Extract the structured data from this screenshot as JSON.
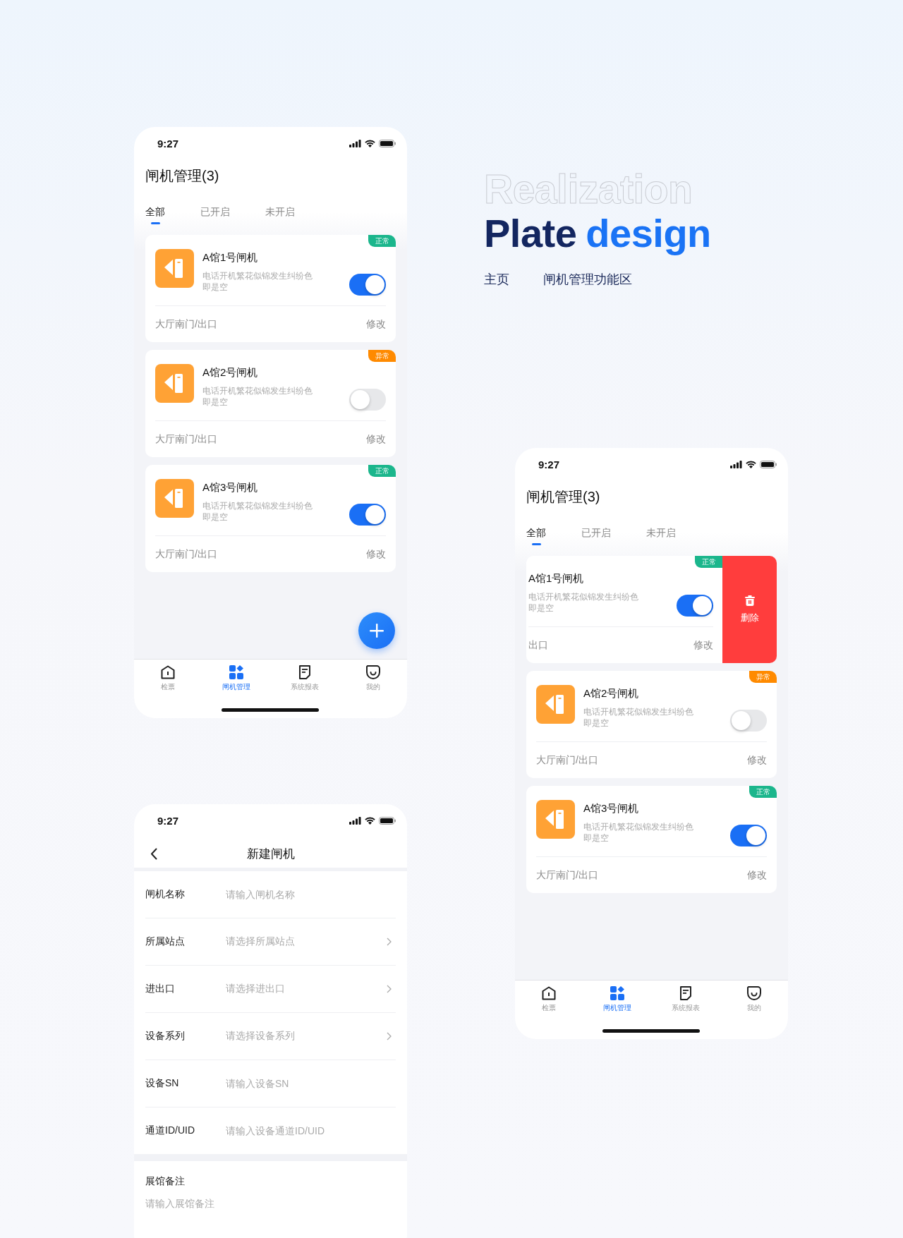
{
  "list_screens": [
    {
      "time": "9:27",
      "title": "闸机管理(3)",
      "tabs": [
        {
          "label": "全部",
          "selected": true
        },
        {
          "label": "已开启",
          "selected": false
        },
        {
          "label": "未开启",
          "selected": false
        }
      ],
      "cards": [
        {
          "name": "A馆1号闸机",
          "desc": "电话开机繁花似锦发生纠纷色即是空",
          "location": "大厅南门/出口",
          "edit": "修改",
          "status": "正常",
          "color": "#1bb68c",
          "on": true,
          "swiped": false
        },
        {
          "name": "A馆2号闸机",
          "desc": "电话开机繁花似锦发生纠纷色即是空",
          "location": "大厅南门/出口",
          "edit": "修改",
          "status": "异常",
          "color": "#ff8a00",
          "on": false,
          "swiped": false
        },
        {
          "name": "A馆3号闸机",
          "desc": "电话开机繁花似锦发生纠纷色即是空",
          "location": "大厅南门/出口",
          "edit": "修改",
          "status": "正常",
          "color": "#1bb68c",
          "on": true,
          "swiped": false
        }
      ],
      "fab": true,
      "tabbar": [
        {
          "label": "检票",
          "selected": false
        },
        {
          "label": "闸机管理",
          "selected": true
        },
        {
          "label": "系统报表",
          "selected": false
        },
        {
          "label": "我的",
          "selected": false
        }
      ]
    },
    {
      "time": "9:27",
      "title": "闸机管理(3)",
      "tabs": [
        {
          "label": "全部",
          "selected": true
        },
        {
          "label": "已开启",
          "selected": false
        },
        {
          "label": "未开启",
          "selected": false
        }
      ],
      "cards": [
        {
          "name": "A馆1号闸机",
          "desc": "电话开机繁花似锦发生纠纷色即是空",
          "location": "出口",
          "edit": "修改",
          "status": "正常",
          "color": "#1bb68c",
          "on": true,
          "swiped": true,
          "delete_label": "删除"
        },
        {
          "name": "A馆2号闸机",
          "desc": "电话开机繁花似锦发生纠纷色即是空",
          "location": "大厅南门/出口",
          "edit": "修改",
          "status": "异常",
          "color": "#ff8a00",
          "on": false,
          "swiped": false
        },
        {
          "name": "A馆3号闸机",
          "desc": "电话开机繁花似锦发生纠纷色即是空",
          "location": "大厅南门/出口",
          "edit": "修改",
          "status": "正常",
          "color": "#1bb68c",
          "on": true,
          "swiped": false
        }
      ],
      "fab": false,
      "tabbar": [
        {
          "label": "检票",
          "selected": false
        },
        {
          "label": "闸机管理",
          "selected": true
        },
        {
          "label": "系统报表",
          "selected": false
        },
        {
          "label": "我的",
          "selected": false
        }
      ]
    }
  ],
  "heading": {
    "outline_title": "Realization",
    "title": "Plate",
    "title_accent": "design",
    "labels": [
      "主页",
      "闸机管理功能区"
    ]
  },
  "form_screen": {
    "time": "9:27",
    "title": "新建闸机",
    "fields": [
      {
        "label": "闸机名称",
        "placeholder": "请输入闸机名称",
        "kind": "input"
      },
      {
        "label": "所属站点",
        "placeholder": "请选择所属站点",
        "kind": "select"
      },
      {
        "label": "进出口",
        "placeholder": "请选择进出口",
        "kind": "select"
      },
      {
        "label": "设备系列",
        "placeholder": "请选择设备系列",
        "kind": "select"
      },
      {
        "label": "设备SN",
        "placeholder": "请输入设备SN",
        "kind": "input"
      },
      {
        "label": "通道ID/UID",
        "placeholder": "请输入设备通道ID/UID",
        "kind": "input"
      }
    ],
    "note": {
      "label": "展馆备注",
      "placeholder": "请输入展馆备注"
    }
  }
}
